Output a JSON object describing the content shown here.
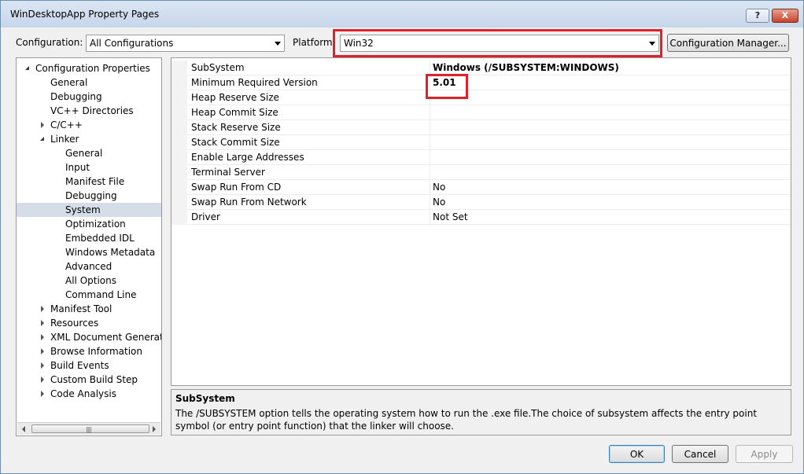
{
  "window": {
    "title": "WinDesktopApp Property Pages",
    "help_label": "?",
    "close_label": "X"
  },
  "toolbar": {
    "configuration_label": "Configuration:",
    "configuration_value": "All Configurations",
    "platform_label": "Platform:",
    "platform_value": "Win32",
    "config_manager_label": "Configuration Manager..."
  },
  "tree": {
    "items": [
      {
        "label": "Configuration Properties",
        "state": "expanded"
      },
      {
        "label": "General"
      },
      {
        "label": "Debugging"
      },
      {
        "label": "VC++ Directories"
      },
      {
        "label": "C/C++",
        "state": "collapsed"
      },
      {
        "label": "Linker",
        "state": "expanded"
      },
      {
        "label": "General"
      },
      {
        "label": "Input"
      },
      {
        "label": "Manifest File"
      },
      {
        "label": "Debugging"
      },
      {
        "label": "System",
        "selected": true
      },
      {
        "label": "Optimization"
      },
      {
        "label": "Embedded IDL"
      },
      {
        "label": "Windows Metadata"
      },
      {
        "label": "Advanced"
      },
      {
        "label": "All Options"
      },
      {
        "label": "Command Line"
      },
      {
        "label": "Manifest Tool",
        "state": "collapsed"
      },
      {
        "label": "Resources",
        "state": "collapsed"
      },
      {
        "label": "XML Document Generator",
        "state": "collapsed"
      },
      {
        "label": "Browse Information",
        "state": "collapsed"
      },
      {
        "label": "Build Events",
        "state": "collapsed"
      },
      {
        "label": "Custom Build Step",
        "state": "collapsed"
      },
      {
        "label": "Code Analysis",
        "state": "collapsed"
      }
    ],
    "scroll_grip": "||||"
  },
  "properties": {
    "rows": [
      {
        "name": "SubSystem",
        "value": "Windows (/SUBSYSTEM:WINDOWS)",
        "bold": true
      },
      {
        "name": "Minimum Required Version",
        "value": "5.01",
        "bold": true
      },
      {
        "name": "Heap Reserve Size",
        "value": ""
      },
      {
        "name": "Heap Commit Size",
        "value": ""
      },
      {
        "name": "Stack Reserve Size",
        "value": ""
      },
      {
        "name": "Stack Commit Size",
        "value": ""
      },
      {
        "name": "Enable Large Addresses",
        "value": ""
      },
      {
        "name": "Terminal Server",
        "value": ""
      },
      {
        "name": "Swap Run From CD",
        "value": "No"
      },
      {
        "name": "Swap Run From Network",
        "value": "No"
      },
      {
        "name": "Driver",
        "value": "Not Set"
      }
    ]
  },
  "description": {
    "title": "SubSystem",
    "text": "The /SUBSYSTEM option tells the operating system how to run the .exe file.The choice of subsystem affects the entry point symbol (or entry point function) that the linker will choose."
  },
  "buttons": {
    "ok": "OK",
    "cancel": "Cancel",
    "apply": "Apply"
  },
  "colors": {
    "highlight": "#e0202a",
    "selection": "#d5dde8",
    "titlebar": "#c6d6ea"
  }
}
